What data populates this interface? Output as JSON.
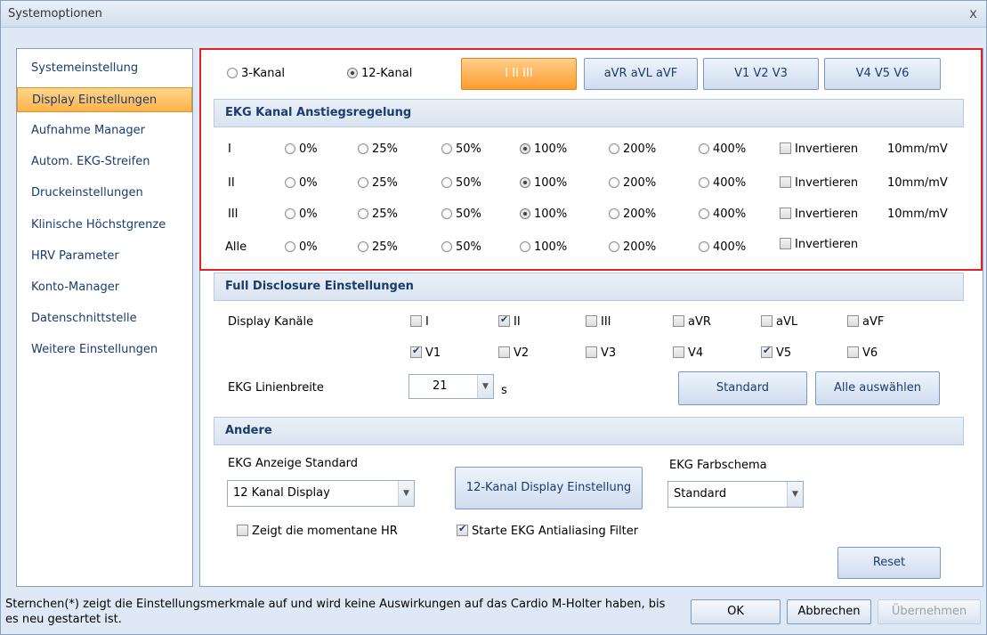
{
  "window": {
    "title": "Systemoptionen",
    "close_glyph": "x"
  },
  "nav": {
    "items": [
      "Systemeinstellung",
      "Display Einstellungen",
      "Aufnahme Manager",
      "Autom. EKG-Streifen",
      "Druckeinstellungen",
      "Klinische Höchstgrenze",
      "HRV Parameter",
      "Konto-Manager",
      "Datenschnittstelle",
      "Weitere Einstellungen"
    ],
    "selected_index": 1
  },
  "channel_mode": {
    "option_3": "3-Kanal",
    "option_12": "12-Kanal",
    "selected": "12-Kanal"
  },
  "lead_groups": [
    "I II III",
    "aVR aVL aVF",
    "V1 V2 V3",
    "V4 V5 V6"
  ],
  "gain": {
    "title": "EKG Kanal Anstiegsregelung",
    "options": [
      "0%",
      "25%",
      "50%",
      "100%",
      "200%",
      "400%"
    ],
    "invert_label": "Invertieren",
    "rows": [
      {
        "label": "I",
        "selected": "100%",
        "invert": false,
        "unit": "10mm/mV"
      },
      {
        "label": "II",
        "selected": "100%",
        "invert": false,
        "unit": "10mm/mV"
      },
      {
        "label": "III",
        "selected": "100%",
        "invert": false,
        "unit": "10mm/mV"
      },
      {
        "label": "Alle",
        "selected": "",
        "invert": false,
        "unit": ""
      }
    ]
  },
  "full_disclosure": {
    "title": "Full Disclosure Einstellungen",
    "display_label": "Display Kanäle",
    "channels": [
      {
        "name": "I",
        "checked": false
      },
      {
        "name": "II",
        "checked": true
      },
      {
        "name": "III",
        "checked": false
      },
      {
        "name": "aVR",
        "checked": false
      },
      {
        "name": "aVL",
        "checked": false
      },
      {
        "name": "aVF",
        "checked": false
      },
      {
        "name": "V1",
        "checked": true
      },
      {
        "name": "V2",
        "checked": false
      },
      {
        "name": "V3",
        "checked": false
      },
      {
        "name": "V4",
        "checked": false
      },
      {
        "name": "V5",
        "checked": true
      },
      {
        "name": "V6",
        "checked": false
      }
    ],
    "linewidth_label": "EKG Linienbreite",
    "linewidth_value": "21",
    "linewidth_unit": "s",
    "standard_button": "Standard",
    "select_all_button": "Alle auswählen"
  },
  "other": {
    "title": "Andere",
    "display_default_label": "EKG Anzeige Standard",
    "display_default_value": "12 Kanal Display",
    "display_settings_button": "12-Kanal Display Einstellung",
    "color_scheme_label": "EKG Farbschema",
    "color_scheme_value": "Standard",
    "show_hr_label": "Zeigt die momentane HR",
    "show_hr_checked": false,
    "antialias_label": "Starte EKG Antialiasing Filter",
    "antialias_checked": true,
    "reset_button": "Reset"
  },
  "footer": {
    "note": "Sternchen(*) zeigt die Einstellungsmerkmale auf und wird keine Auswirkungen auf das Cardio M-Holter haben, bis es neu gestartet ist.",
    "ok": "OK",
    "cancel": "Abbrechen",
    "apply": "Übernehmen"
  },
  "colors": {
    "accent_orange": "#ff9d2f",
    "highlight_red": "#e0202a",
    "header_blue": "#1a3c6e"
  }
}
